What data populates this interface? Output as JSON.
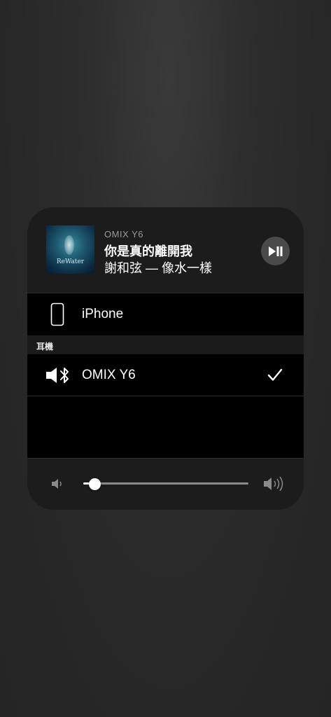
{
  "now_playing": {
    "device_name": "OMIX Y6",
    "song_title": "你是真的離開我",
    "artist_album": "謝和弦 — 像水一樣",
    "album_art_text": "ReWater"
  },
  "devices": [
    {
      "label": "iPhone",
      "icon": "iphone-icon",
      "selected": false
    }
  ],
  "headphones_section": {
    "header": "耳機",
    "devices": [
      {
        "label": "OMIX Y6",
        "icon": "speaker-bluetooth-icon",
        "selected": true,
        "check_icon": "checkmark-icon"
      }
    ]
  },
  "volume": {
    "level": 0.07
  }
}
